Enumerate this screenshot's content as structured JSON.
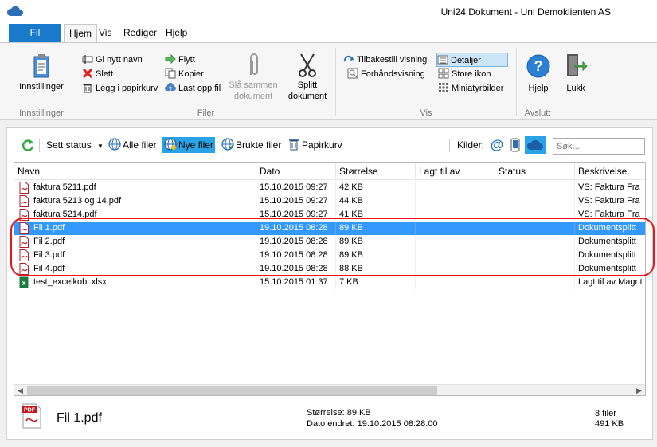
{
  "window": {
    "title": "Uni24 Dokument - Uni Demoklienten AS"
  },
  "menu": {
    "file_tab": "Fil",
    "tabs": [
      "Hjem",
      "Vis",
      "Rediger",
      "Hjelp"
    ]
  },
  "ribbon": {
    "innstillinger": {
      "button": "Innstillinger",
      "group": "Innstillinger"
    },
    "filer": {
      "rename": "Gi nytt navn",
      "delete": "Slett",
      "to_trash": "Legg i papirkurv",
      "move": "Flytt",
      "copy": "Kopier",
      "upload": "Last opp fil",
      "merge_line1": "Slå sammen",
      "merge_line2": "dokument",
      "split_line1": "Splitt",
      "split_line2": "dokument",
      "group": "Filer"
    },
    "vis": {
      "reset": "Tilbakestill visning",
      "preview": "Forhåndsvisning",
      "details": "Detaljer",
      "large_icons": "Store ikon",
      "thumbnails": "Miniatyrbilder",
      "group": "Vis"
    },
    "avslutt": {
      "help": "Hjelp",
      "close": "Lukk",
      "group": "Avslutt"
    }
  },
  "toolbar": {
    "set_status": "Sett status",
    "all_files": "Alle filer",
    "new_files": "Nye filer",
    "used_files": "Brukte filer",
    "trash": "Papirkurv",
    "sources_label": "Kilder:",
    "search_placeholder": "Søk..."
  },
  "table": {
    "columns": [
      "Navn",
      "Dato",
      "Størrelse",
      "Lagt til av",
      "Status",
      "Beskrivelse"
    ],
    "rows": [
      {
        "name": "faktura 5211.pdf",
        "date": "15.10.2015 09:27",
        "size": "42 KB",
        "added_by": "",
        "status": "",
        "description": "VS: Faktura Fra",
        "type": "pdf",
        "selected": false
      },
      {
        "name": "faktura 5213 og 14.pdf",
        "date": "15.10.2015 09:27",
        "size": "44 KB",
        "added_by": "",
        "status": "",
        "description": "VS: Faktura Fra",
        "type": "pdf",
        "selected": false
      },
      {
        "name": "faktura 5214.pdf",
        "date": "15.10.2015 09:27",
        "size": "41 KB",
        "added_by": "",
        "status": "",
        "description": "VS: Faktura Fra",
        "type": "pdf",
        "selected": false
      },
      {
        "name": "Fil 1.pdf",
        "date": "19.10.2015 08:28",
        "size": "89 KB",
        "added_by": "",
        "status": "",
        "description": "Dokumentsplitt",
        "type": "pdf",
        "selected": true
      },
      {
        "name": "Fil 2.pdf",
        "date": "19.10.2015 08:28",
        "size": "89 KB",
        "added_by": "",
        "status": "",
        "description": "Dokumentsplitt",
        "type": "pdf",
        "selected": false
      },
      {
        "name": "Fil 3.pdf",
        "date": "19.10.2015 08:28",
        "size": "89 KB",
        "added_by": "",
        "status": "",
        "description": "Dokumentsplitt",
        "type": "pdf",
        "selected": false
      },
      {
        "name": "Fil 4.pdf",
        "date": "19.10.2015 08:28",
        "size": "88 KB",
        "added_by": "",
        "status": "",
        "description": "Dokumentsplitt",
        "type": "pdf",
        "selected": false
      },
      {
        "name": "test_excelkobl.xlsx",
        "date": "15.10.2015 01:37",
        "size": "7 KB",
        "added_by": "",
        "status": "",
        "description": "Lagt til av Magrit",
        "type": "xlsx",
        "selected": false
      }
    ]
  },
  "statusbar": {
    "selected_name": "Fil 1.pdf",
    "size_line": "Størrelse: 89 KB",
    "date_line": "Dato endret: 19.10.2015 08:28:00",
    "count_line": "8 filer",
    "total_line": "491 KB"
  },
  "colors": {
    "accent": "#1979ca",
    "selection": "#3399ff",
    "highlight_box": "#e8141a",
    "active_filter": "#29a2e6"
  }
}
